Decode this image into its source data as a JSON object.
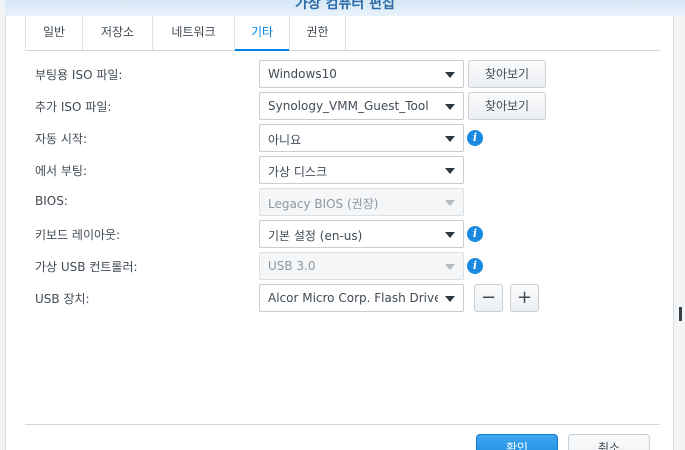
{
  "window": {
    "title": "가상 컴퓨터 편집"
  },
  "tabs": [
    {
      "label": "일반"
    },
    {
      "label": "저장소"
    },
    {
      "label": "네트워크"
    },
    {
      "label": "기타",
      "active": true
    },
    {
      "label": "권한"
    }
  ],
  "form": {
    "boot_iso": {
      "label": "부팅용 ISO 파일:",
      "value": "Windows10",
      "browse_label": "찾아보기"
    },
    "extra_iso": {
      "label": "추가 ISO 파일:",
      "value": "Synology_VMM_Guest_Tool",
      "browse_label": "찾아보기"
    },
    "autostart": {
      "label": "자동 시작:",
      "value": "아니요"
    },
    "boot_from": {
      "label": "에서 부팅:",
      "value": "가상 디스크"
    },
    "bios": {
      "label": "BIOS:",
      "value": "Legacy BIOS (권장)"
    },
    "keyboard_layout": {
      "label": "키보드 레이아웃:",
      "value": "기본 설정 (en-us)"
    },
    "usb_controller": {
      "label": "가상 USB 컨트롤러:",
      "value": "USB 3.0"
    },
    "usb_device": {
      "label": "USB 장치:",
      "value": "Alcor Micro Corp. Flash Drive",
      "remove_label": "−",
      "add_label": "+"
    }
  },
  "footer": {
    "ok_label": "확인",
    "cancel_label": "취소"
  },
  "icons": {
    "info": "info-icon",
    "dropdown": "chevron-down-icon"
  },
  "colors": {
    "accent": "#0086e5",
    "info": "#1a8ae0"
  }
}
